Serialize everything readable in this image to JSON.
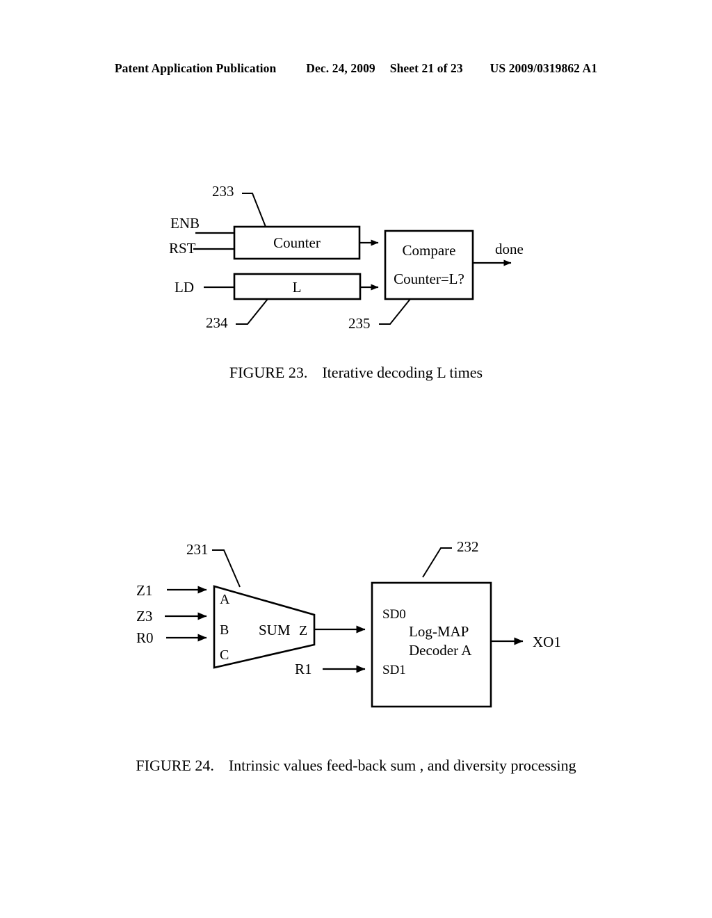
{
  "header": {
    "publication": "Patent Application Publication",
    "date": "Dec. 24, 2009",
    "sheet": "Sheet 21 of 23",
    "patent_number": "US 2009/0319862 A1"
  },
  "figure23": {
    "caption_label": "FIGURE 23.",
    "caption_text": "Iterative decoding L times",
    "blocks": {
      "counter": "Counter",
      "l_register": "L",
      "compare_line1": "Compare",
      "compare_line2": "Counter=L?"
    },
    "inputs": {
      "enb": "ENB",
      "rst": "RST",
      "ld": "LD"
    },
    "outputs": {
      "done": "done"
    },
    "refs": {
      "counter_ref": "233",
      "l_ref": "234",
      "compare_ref": "235"
    }
  },
  "figure24": {
    "caption_label": "FIGURE 24.",
    "caption_text": "Intrinsic values feed-back sum , and diversity processing",
    "sum_block": {
      "name": "SUM",
      "port_a": "A",
      "port_b": "B",
      "port_c": "C",
      "port_z": "Z"
    },
    "decoder_block": {
      "line1": "Log-MAP",
      "line2": "Decoder A",
      "port_sd0": "SD0",
      "port_sd1": "SD1"
    },
    "inputs": {
      "z1": "Z1",
      "z3": "Z3",
      "r0": "R0",
      "r1": "R1"
    },
    "outputs": {
      "xo1": "XO1"
    },
    "refs": {
      "sum_ref": "231",
      "decoder_ref": "232"
    }
  },
  "colors": {
    "ink": "#000000",
    "paper": "#ffffff"
  }
}
